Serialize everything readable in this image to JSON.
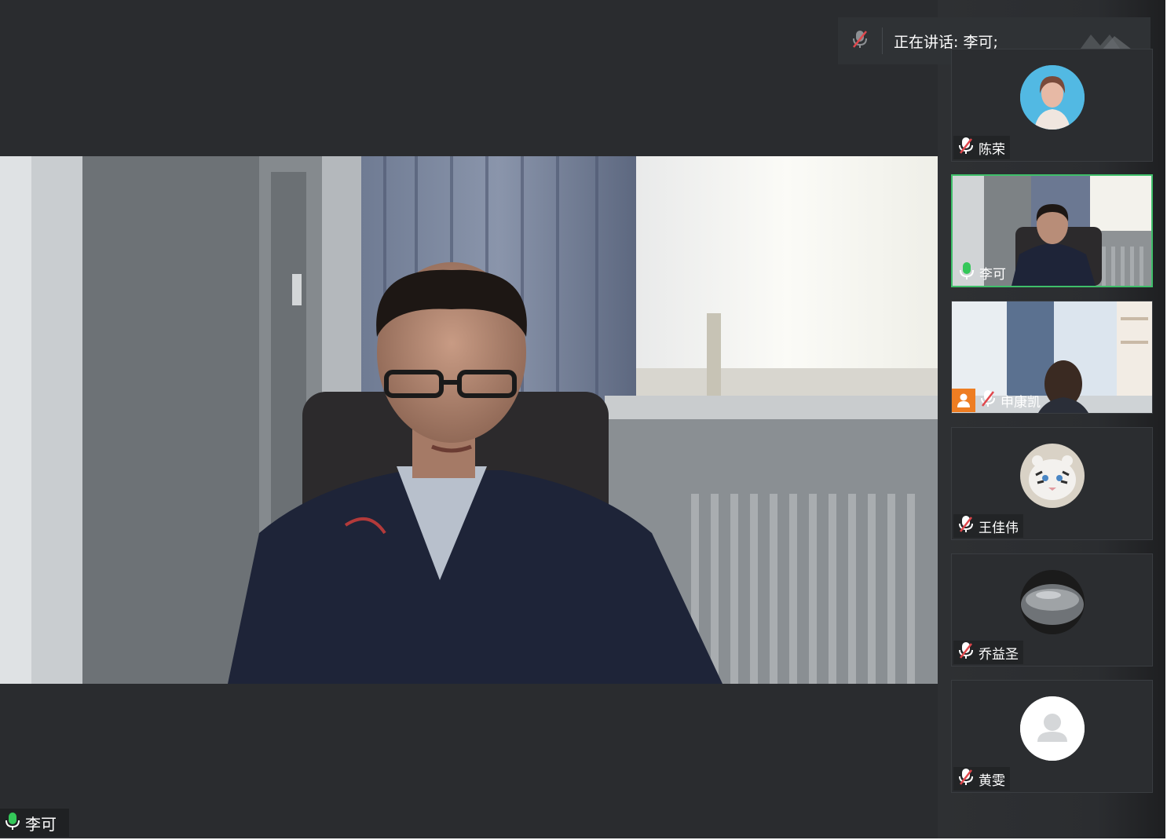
{
  "app": {
    "speaking_label": "正在讲话: 李可;",
    "colors": {
      "background": "#2a2c2f",
      "active_border": "#3fbf6a",
      "mic_active": "#34c759",
      "mic_muted": "#e0474c",
      "guest_avatar": "#ee7d22"
    }
  },
  "main_video": {
    "speaker_name": "李可",
    "mic_state": "active",
    "icon": "mic-icon"
  },
  "participants": [
    {
      "name": "陈荣",
      "mic_state": "muted",
      "view": "avatar",
      "avatar": "portrait-photo"
    },
    {
      "name": "李可",
      "mic_state": "active",
      "view": "video",
      "active": true
    },
    {
      "name": "申康凯",
      "mic_state": "muted",
      "view": "video",
      "badge": "guest-user-icon"
    },
    {
      "name": "王佳伟",
      "mic_state": "muted",
      "view": "avatar",
      "avatar": "white-tiger-photo"
    },
    {
      "name": "乔益圣",
      "mic_state": "muted",
      "view": "avatar",
      "avatar": "stone-photo"
    },
    {
      "name": "黄雯",
      "mic_state": "muted",
      "view": "avatar",
      "avatar": "default-user-icon"
    }
  ]
}
